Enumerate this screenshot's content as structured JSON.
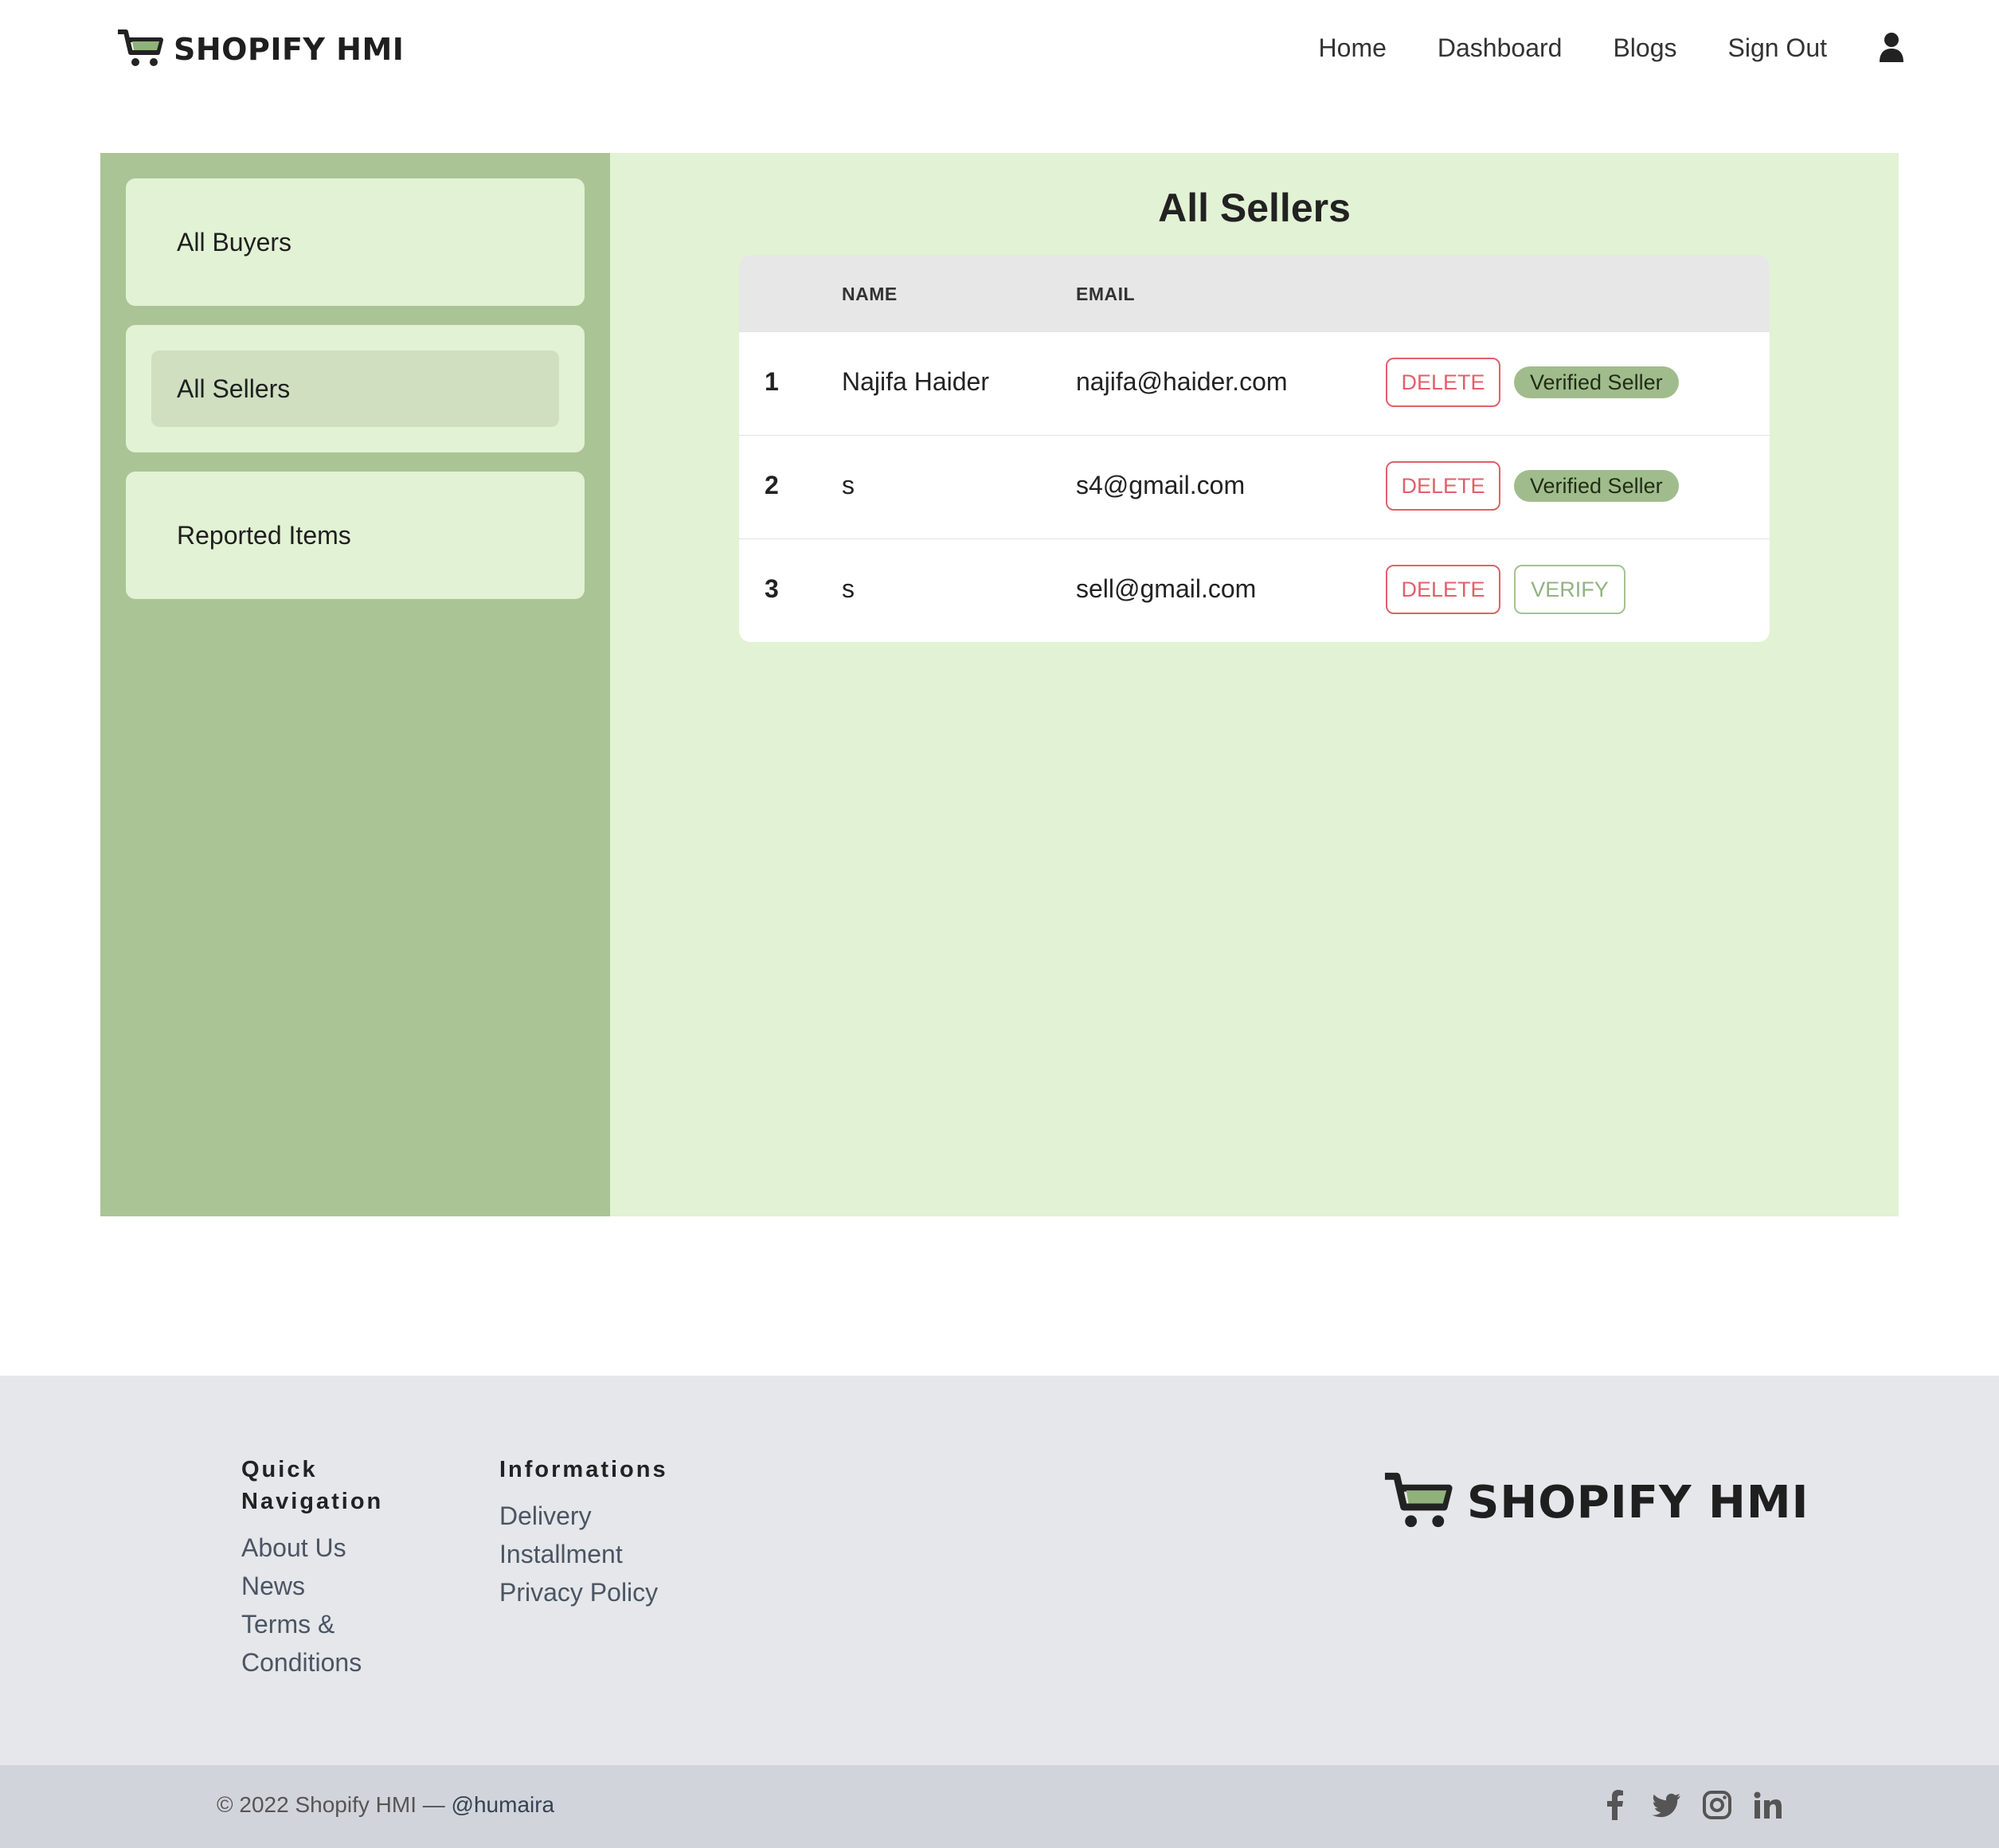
{
  "header": {
    "brand": "SHOPIFY HMI",
    "nav": [
      "Home",
      "Dashboard",
      "Blogs",
      "Sign Out"
    ]
  },
  "sidebar": {
    "items": [
      {
        "label": "All Buyers",
        "active": false
      },
      {
        "label": "All Sellers",
        "active": true
      },
      {
        "label": "Reported Items",
        "active": false
      }
    ]
  },
  "main": {
    "title": "All Sellers",
    "columns": [
      "",
      "NAME",
      "EMAIL",
      ""
    ],
    "rows": [
      {
        "num": "1",
        "name": "Najifa Haider",
        "email": "najifa@haider.com",
        "delete": "DELETE",
        "status": "Verified Seller",
        "verified": true
      },
      {
        "num": "2",
        "name": "s",
        "email": "s4@gmail.com",
        "delete": "DELETE",
        "status": "Verified Seller",
        "verified": true
      },
      {
        "num": "3",
        "name": "s",
        "email": "sell@gmail.com",
        "delete": "DELETE",
        "status": "VERIFY",
        "verified": false
      }
    ]
  },
  "footer": {
    "quick_nav": {
      "heading_line1": "Quick",
      "heading_line2": "Navigation",
      "links": [
        "About Us",
        "News",
        "Terms &",
        "Conditions"
      ]
    },
    "informations": {
      "heading": "Informations",
      "links": [
        "Delivery",
        "Installment",
        "Privacy Policy"
      ]
    },
    "brand": "SHOPIFY HMI",
    "copyright_prefix": "© 2022 Shopify HMI —",
    "copyright_handle": "@humaira",
    "socials": [
      "facebook-icon",
      "twitter-icon",
      "instagram-icon",
      "linkedin-icon"
    ]
  },
  "colors": {
    "sidebar_bg": "#abc495",
    "content_bg": "#e2f2d4",
    "delete": "#e0606a",
    "badge": "#a1bc8c",
    "footer_bg": "#e5e7eb",
    "bottom_bar": "#d1d5db"
  }
}
